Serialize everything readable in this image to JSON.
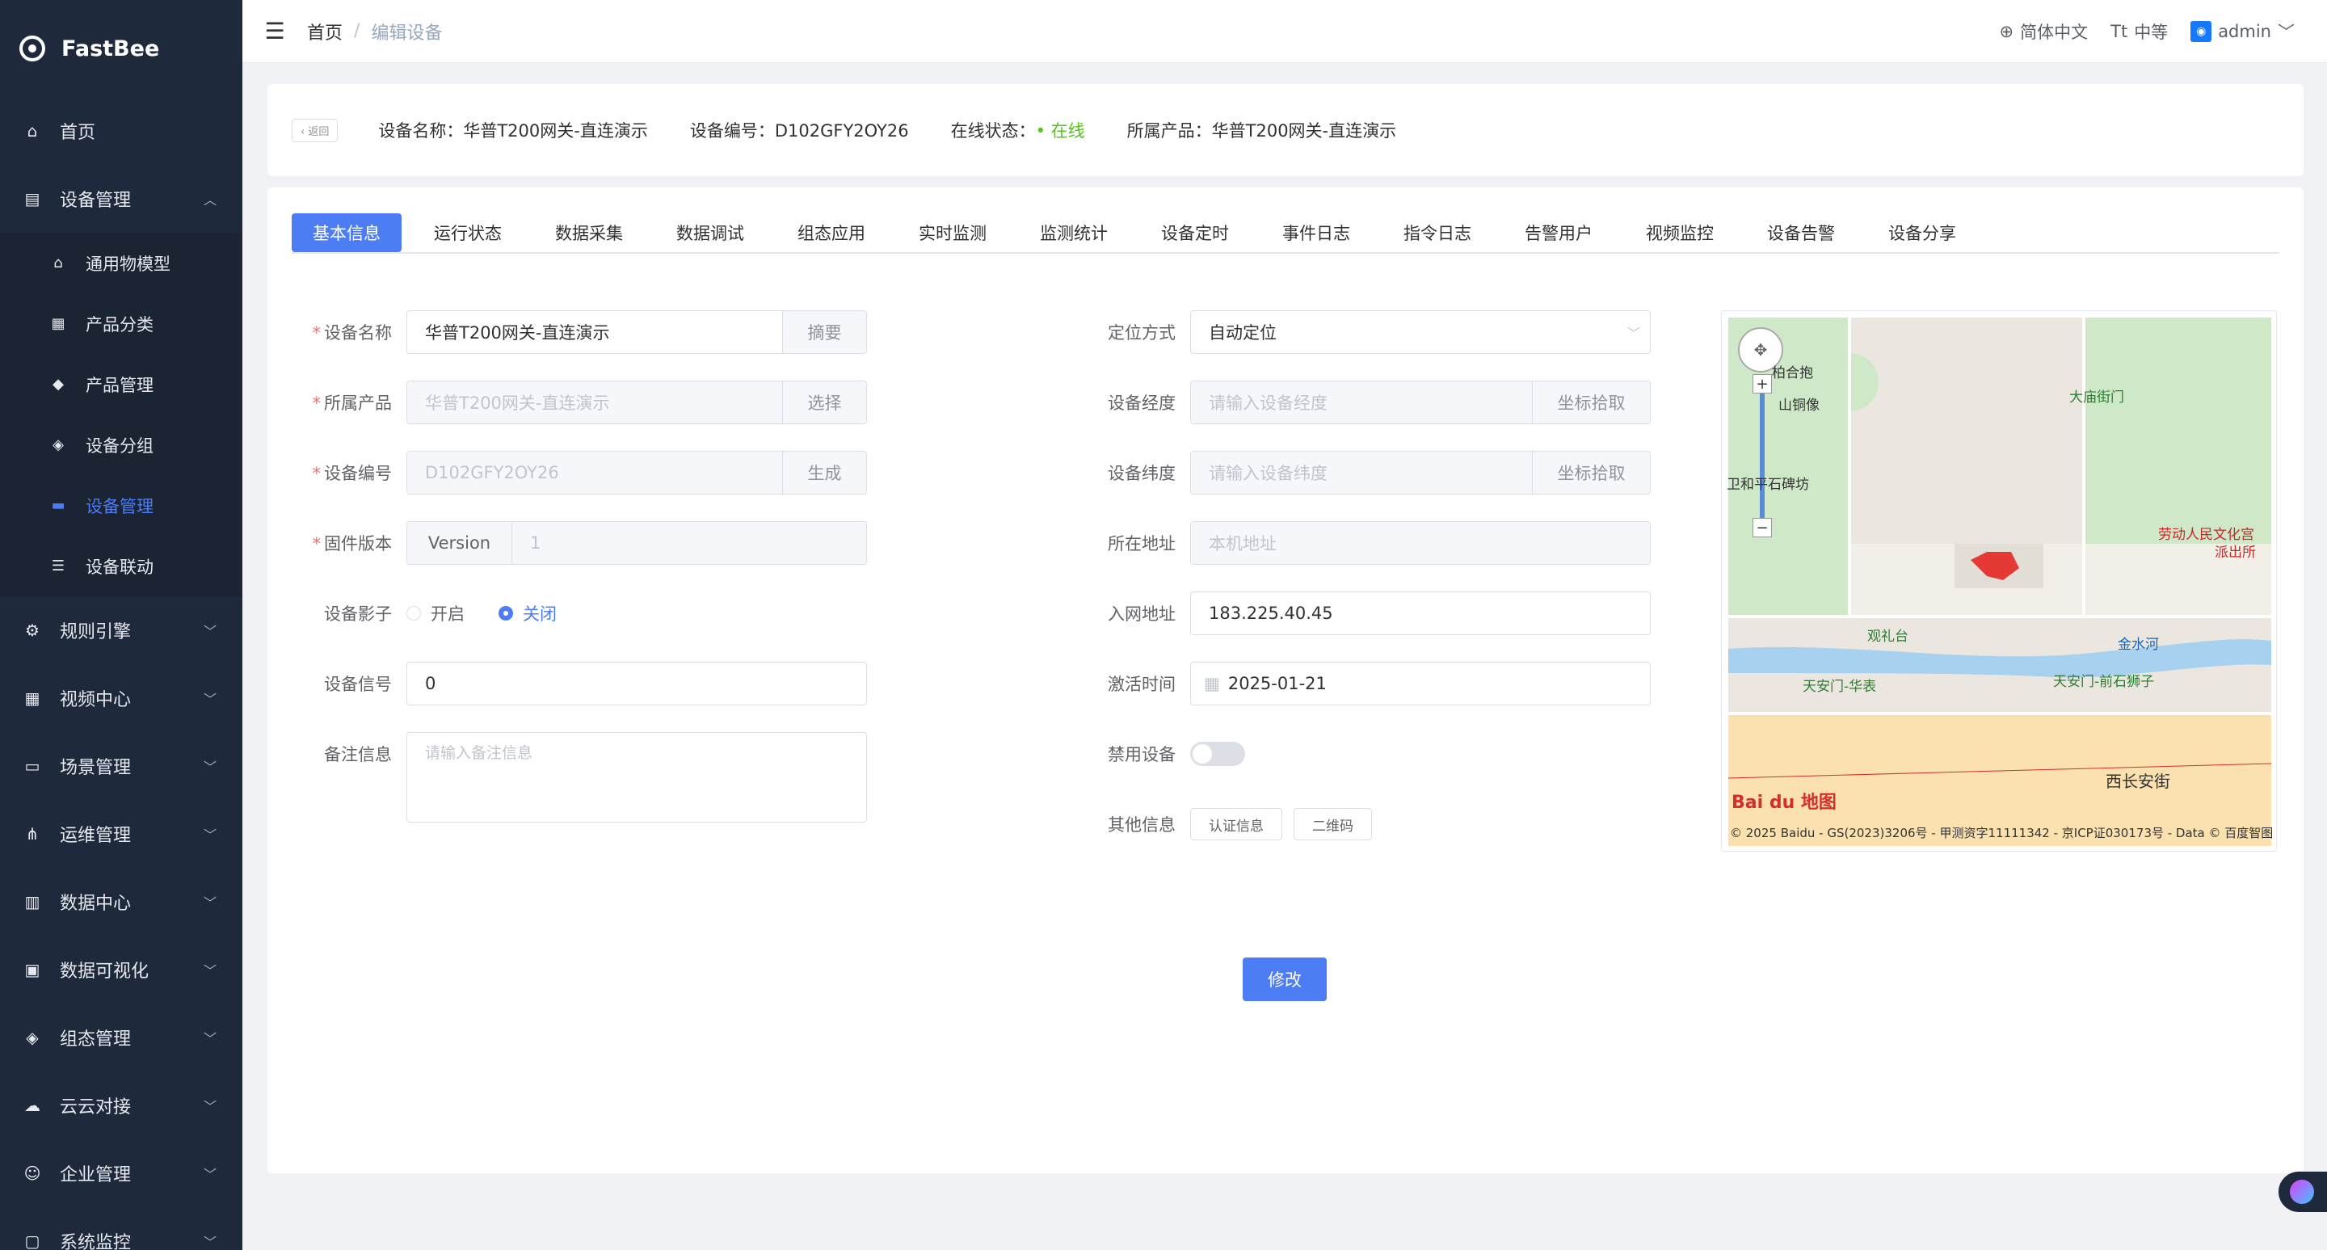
{
  "app": {
    "name": "FastBee"
  },
  "sidebar": {
    "items": [
      {
        "label": "首页",
        "icon": "home-icon",
        "glyph": "⌂"
      },
      {
        "label": "设备管理",
        "icon": "device-icon",
        "glyph": "▤",
        "arrow": "︿"
      },
      {
        "label": "规则引擎",
        "icon": "rule-icon",
        "glyph": "⚙",
        "arrow": "﹀"
      },
      {
        "label": "视频中心",
        "icon": "video-icon",
        "glyph": "▦",
        "arrow": "﹀"
      },
      {
        "label": "场景管理",
        "icon": "scene-icon",
        "glyph": "▭",
        "arrow": "﹀"
      },
      {
        "label": "运维管理",
        "icon": "ops-icon",
        "glyph": "⋔",
        "arrow": "﹀"
      },
      {
        "label": "数据中心",
        "icon": "data-icon",
        "glyph": "▥",
        "arrow": "﹀"
      },
      {
        "label": "数据可视化",
        "icon": "visual-icon",
        "glyph": "▣",
        "arrow": "﹀"
      },
      {
        "label": "组态管理",
        "icon": "config-icon",
        "glyph": "◈",
        "arrow": "﹀"
      },
      {
        "label": "云云对接",
        "icon": "cloud-icon",
        "glyph": "☁",
        "arrow": "﹀"
      },
      {
        "label": "企业管理",
        "icon": "enterprise-icon",
        "glyph": "☺",
        "arrow": "﹀"
      },
      {
        "label": "系统监控",
        "icon": "monitor-icon",
        "glyph": "▢",
        "arrow": "﹀"
      }
    ],
    "submenu": [
      {
        "label": "通用物模型",
        "icon": "model-icon",
        "glyph": "⌂"
      },
      {
        "label": "产品分类",
        "icon": "category-icon",
        "glyph": "▦"
      },
      {
        "label": "产品管理",
        "icon": "product-icon",
        "glyph": "◆"
      },
      {
        "label": "设备分组",
        "icon": "group-icon",
        "glyph": "◈"
      },
      {
        "label": "设备管理",
        "icon": "device-manage-icon",
        "glyph": "▬"
      },
      {
        "label": "设备联动",
        "icon": "linkage-icon",
        "glyph": "☰"
      }
    ]
  },
  "topbar": {
    "breadcrumb_home": "首页",
    "breadcrumb_sep": "/",
    "breadcrumb_current": "编辑设备",
    "language": "简体中文",
    "font_size": "中等",
    "user": "admin"
  },
  "header": {
    "back": "‹ 返回",
    "device_name": "设备名称：华普T200网关-直连演示",
    "device_code": "设备编号：D102GFY2OY26",
    "status_label": "在线状态：",
    "status_value": "• 在线",
    "product": "所属产品：华普T200网关-直连演示"
  },
  "tabs": [
    "基本信息",
    "运行状态",
    "数据采集",
    "数据调试",
    "组态应用",
    "实时监测",
    "监测统计",
    "设备定时",
    "事件日志",
    "指令日志",
    "告警用户",
    "视频监控",
    "设备告警",
    "设备分享"
  ],
  "form": {
    "device_name": {
      "label": "设备名称",
      "value": "华普T200网关-直连演示",
      "append": "摘要"
    },
    "product": {
      "label": "所属产品",
      "value": "华普T200网关-直连演示",
      "append": "选择"
    },
    "device_code": {
      "label": "设备编号",
      "value": "D102GFY2OY26",
      "append": "生成"
    },
    "firmware": {
      "label": "固件版本",
      "prepend": "Version",
      "value": "1"
    },
    "shadow": {
      "label": "设备影子",
      "on": "开启",
      "off": "关闭"
    },
    "signal": {
      "label": "设备信号",
      "value": "0"
    },
    "remark": {
      "label": "备注信息",
      "placeholder": "请输入备注信息"
    },
    "locate_mode": {
      "label": "定位方式",
      "value": "自动定位"
    },
    "longitude": {
      "label": "设备经度",
      "placeholder": "请输入设备经度",
      "append": "坐标拾取"
    },
    "latitude": {
      "label": "设备纬度",
      "placeholder": "请输入设备纬度",
      "append": "坐标拾取"
    },
    "address": {
      "label": "所在地址",
      "placeholder": "本机地址"
    },
    "network_addr": {
      "label": "入网地址",
      "value": "183.225.40.45"
    },
    "activate_time": {
      "label": "激活时间",
      "value": "2025-01-21"
    },
    "disable": {
      "label": "禁用设备"
    },
    "other": {
      "label": "其他信息",
      "btn1": "认证信息",
      "btn2": "二维码"
    },
    "submit": "修改"
  },
  "map": {
    "labels": [
      "柏合抱",
      "山铜像",
      "大庙街门",
      "卫和平石碑坊",
      "劳动人民文化宫",
      "派出所",
      "观礼台",
      "金水河",
      "天安门-华表",
      "天安门-前石狮子",
      "西长安街"
    ],
    "logo": "Bai du 地图",
    "copyright": "© 2025 Baidu - GS(2023)3206号 - 甲测资字11111342 - 京ICP证030173号 - Data © 百度智图"
  },
  "colors": {
    "primary": "#4c7df5",
    "sidebar_bg": "#1e2a3c",
    "online": "#52c41a",
    "required": "#f56c6c"
  }
}
